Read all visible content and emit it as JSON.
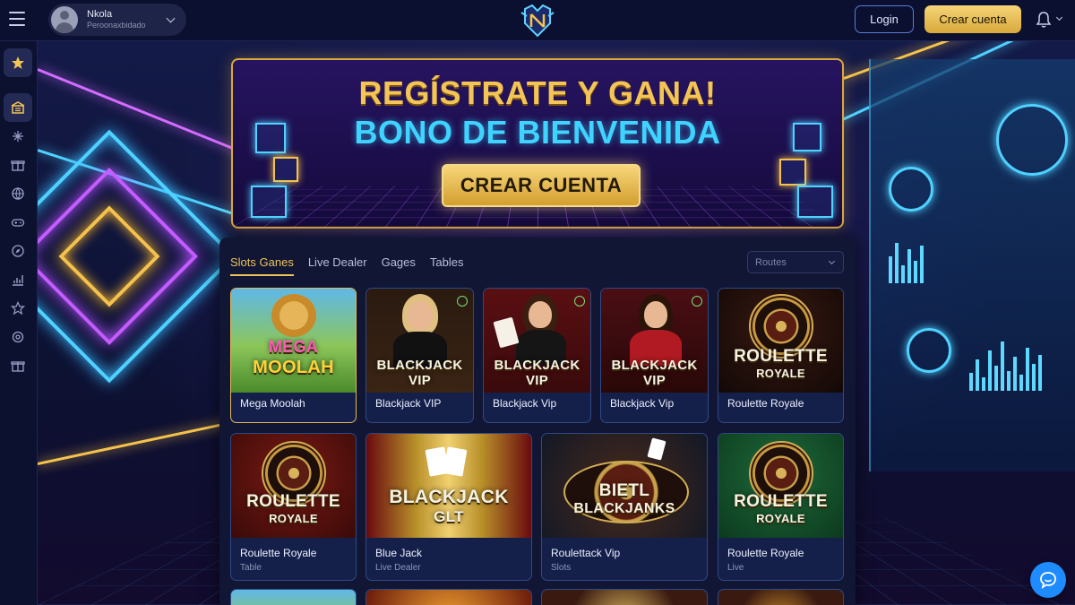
{
  "header": {
    "user_name": "Nkola",
    "user_subtitle": "Peroonaxbidado",
    "login_label": "Login",
    "create_account_label": "Crear cuenta",
    "icons": [
      "menu-icon",
      "avatar",
      "chevron-down-icon",
      "logo-emblem",
      "bell-icon"
    ]
  },
  "sidebar": {
    "items": [
      {
        "icon": "star-icon",
        "active": true
      },
      {
        "icon": "casino-icon",
        "active": true
      },
      {
        "icon": "sparkle-icon"
      },
      {
        "icon": "gift-icon"
      },
      {
        "icon": "ball-icon"
      },
      {
        "icon": "gamepad-icon"
      },
      {
        "icon": "compass-icon"
      },
      {
        "icon": "chart-icon"
      },
      {
        "icon": "star-outline-icon"
      },
      {
        "icon": "settings-icon"
      },
      {
        "icon": "gift-icon"
      }
    ]
  },
  "banner": {
    "title": "REGÍSTRATE Y GANA!",
    "subtitle": "BONO DE BIENVENIDA",
    "cta": "CREAR CUENTA",
    "colors": {
      "title": "#f3c456",
      "subtitle": "#3fd3ff",
      "border": "#d9a93b"
    }
  },
  "games": {
    "tabs": [
      "Slots Ganes",
      "Live Dealer",
      "Gages",
      "Tables"
    ],
    "active_tab": 0,
    "filter_placeholder": "Routes",
    "row1": [
      {
        "title": "Mega Moolah",
        "thumb_line1": "MEGA",
        "thumb_line2": "MOOLAH",
        "selected": true
      },
      {
        "title": "Blackjack VIP",
        "thumb_line1": "BLACKJACK",
        "thumb_line2": "VIP"
      },
      {
        "title": "Blackjack Vip",
        "thumb_line1": "BLACKJACK",
        "thumb_line2": "VIP"
      },
      {
        "title": "Blackjack Vip",
        "thumb_line1": "BLACKJACK",
        "thumb_line2": "VIP"
      },
      {
        "title": "Roulette Royale",
        "thumb_line1": "ROULETTE",
        "thumb_line2": "ROYALE"
      }
    ],
    "row2": [
      {
        "title": "Roulette Royale",
        "category": "Table",
        "thumb_line1": "ROULETTE",
        "thumb_line2": "ROYALE"
      },
      {
        "title": "Blue Jack",
        "category": "Live Dealer",
        "thumb_line1": "BLACKJACK",
        "thumb_line2": "GLT"
      },
      {
        "title": "Roulettack Vip",
        "category": "Slots",
        "thumb_line1": "BIETL",
        "thumb_line2": "BLACKJANKS"
      },
      {
        "title": "Roulette Royale",
        "category": "Live",
        "thumb_line1": "ROULETTE",
        "thumb_line2": "ROYALE"
      }
    ]
  },
  "support": {
    "icon": "chat-icon"
  }
}
